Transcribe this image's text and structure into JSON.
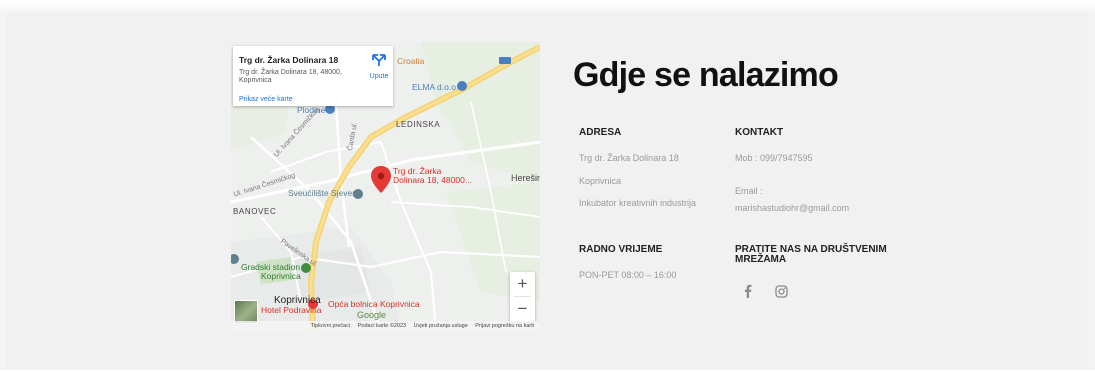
{
  "map": {
    "info_card": {
      "title": "Trg dr. Žarka Dolinara 18",
      "address_line1": "Trg dr. Žarka Dolinara 18, 48000,",
      "address_line2": "Koprivnica",
      "directions_label": "Upute",
      "larger_map_link": "Prikaz veće karte"
    },
    "labels": {
      "croatia": "Croatia",
      "elma": "ELMA d.o.o",
      "plodine": "Plodine",
      "ledinska": "LEDINSKA",
      "marker_line1": "Trg dr. Žarka",
      "marker_line2": "Dolinara 18, 48000...",
      "sveuciliste": "Sveučilište Sjever",
      "heresin": "Herešin",
      "banovec": "BANOVEC",
      "stadion_line1": "Gradski stadion",
      "stadion_line2": "Koprivnica",
      "koprivnica": "Koprivnica",
      "bolnica": "Opća bolnica Koprivnica",
      "hotel": "Hotel Podravina",
      "google": "Google",
      "road1": "Ul. Ivana Česmičkog",
      "road2": "Čarda ul.",
      "road3": "Pavelinska ul."
    },
    "zoom_in": "+",
    "zoom_out": "−",
    "attribution": {
      "shortcuts": "Tipkovni prečaci",
      "map_data": "Podaci karte ©2023",
      "terms": "Uvjeti pružanja usluge",
      "report": "Prijavi pogrešku na karti"
    }
  },
  "content": {
    "title": "Gdje se nalazimo",
    "address": {
      "heading": "ADRESA",
      "line1": "Trg dr. Žarka Dolinara 18",
      "line2": "Koprivnica",
      "line3": "Inkubator kreativnih industrija"
    },
    "contact": {
      "heading": "KONTAKT",
      "mobile": "Mob : 099/7947595",
      "email_label": "Email :",
      "email": "marishastudiohr@gmail.com"
    },
    "hours": {
      "heading": "RADNO VRIJEME",
      "value": "PON-PET 08:00 – 16:00"
    },
    "social": {
      "heading_line1": "PRATITE NAS NA DRUŠTVENIM",
      "heading_line2": "MREŽAMA",
      "icons": [
        "facebook-icon",
        "instagram-icon"
      ]
    }
  }
}
